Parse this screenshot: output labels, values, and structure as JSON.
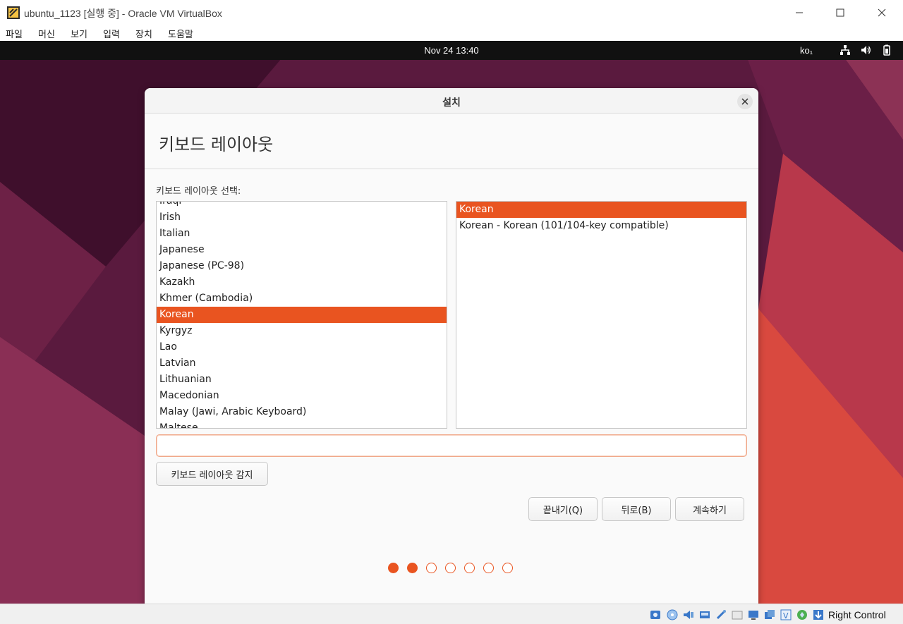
{
  "host": {
    "title": "ubuntu_1123 [실행 중] - Oracle VM VirtualBox",
    "menu": [
      "파일",
      "머신",
      "보기",
      "입력",
      "장치",
      "도움말"
    ],
    "host_key": "Right Control"
  },
  "guest": {
    "clock": "Nov 24  13:40",
    "keyboard_indicator": "ko₁"
  },
  "dialog": {
    "title": "설치",
    "heading": "키보드 레이아웃",
    "select_label": "키보드 레이아웃 선택:",
    "layouts": [
      "Iraqi",
      "Irish",
      "Italian",
      "Japanese",
      "Japanese (PC-98)",
      "Kazakh",
      "Khmer (Cambodia)",
      "Korean",
      "Kyrgyz",
      "Lao",
      "Latvian",
      "Lithuanian",
      "Macedonian",
      "Malay (Jawi, Arabic Keyboard)",
      "Maltese"
    ],
    "selected_layout": "Korean",
    "variants": [
      "Korean",
      "Korean - Korean (101/104-key compatible)"
    ],
    "selected_variant": "Korean",
    "filter_value": "",
    "detect_button": "키보드 레이아웃 감지",
    "quit_button": "끝내기(Q)",
    "back_button": "뒤로(B)",
    "continue_button": "계속하기",
    "progress": {
      "current_step": 2,
      "total_steps": 7
    }
  },
  "colors": {
    "accent": "#e95420",
    "topbar": "#111111",
    "wallpaper": "#5a1a3e"
  }
}
